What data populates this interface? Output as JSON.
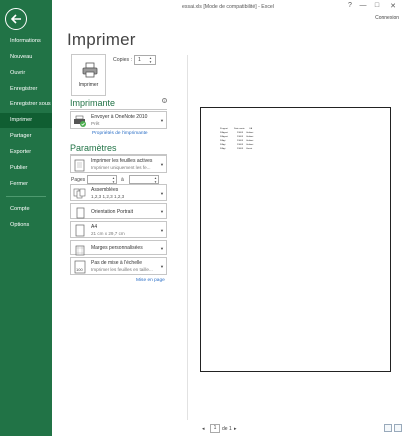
{
  "window": {
    "title": "essai.xls  [Mode de compatibilité] - Excel",
    "help": "?",
    "minimize": "—",
    "maximize": "□",
    "close": "✕",
    "account": "Connexion"
  },
  "nav": {
    "items": [
      {
        "label": "Informations"
      },
      {
        "label": "Nouveau"
      },
      {
        "label": "Ouvrir"
      },
      {
        "label": "Enregistrer"
      },
      {
        "label": "Enregistrer sous"
      },
      {
        "label": "Imprimer",
        "active": true
      },
      {
        "label": "Partager"
      },
      {
        "label": "Exporter"
      },
      {
        "label": "Publier"
      },
      {
        "label": "Fermer"
      },
      {
        "label": "Compte"
      },
      {
        "label": "Options"
      }
    ]
  },
  "print": {
    "title": "Imprimer",
    "button_label": "Imprimer",
    "copies_label": "Copies :",
    "copies_value": "1"
  },
  "printer": {
    "heading": "Imprimante",
    "info": "i",
    "name": "Envoyer à OneNote 2010",
    "status": "Prêt",
    "properties_link": "Propriétés de l'imprimante"
  },
  "settings": {
    "heading": "Paramètres",
    "what": {
      "line1": "Imprimer les feuilles actives",
      "line2": "Imprimer uniquement les fe..."
    },
    "pages_label": "Pages :",
    "pages_to": "à",
    "collate": {
      "line1": "Assemblées",
      "line2": "1,2,3    1,2,3    1,2,3"
    },
    "orientation": {
      "line1": "Orientation Portrait"
    },
    "paper": {
      "line1": "A4",
      "line2": "21 cm x 29,7 cm"
    },
    "margins": {
      "line1": "Marges personnalisées"
    },
    "scaling": {
      "line1": "Pas de mise à l'échelle",
      "line2": "Imprimer les feuilles en taille..."
    },
    "page_setup_link": "Mise en page"
  },
  "preview": {
    "header": [
      "N agent",
      "Date vente",
      "CA"
    ],
    "rows": [
      [
        "N Agent",
        "2/4/03",
        "Giuliani"
      ],
      [
        "N Agent",
        "2/4/03",
        "Giuliani"
      ],
      [
        "N Agt",
        "2/4/03",
        "Giuliani"
      ],
      [
        "N Agt",
        "2/4/03",
        "Giuliani"
      ],
      [
        "N Agt",
        "2/4/03",
        "Veniat"
      ]
    ],
    "page_current": "1",
    "page_of": "de 1",
    "prev": "◂",
    "next": "▸"
  },
  "colors": {
    "accent": "#217346",
    "nav_active": "#105e32",
    "link": "#2a6ec6"
  }
}
